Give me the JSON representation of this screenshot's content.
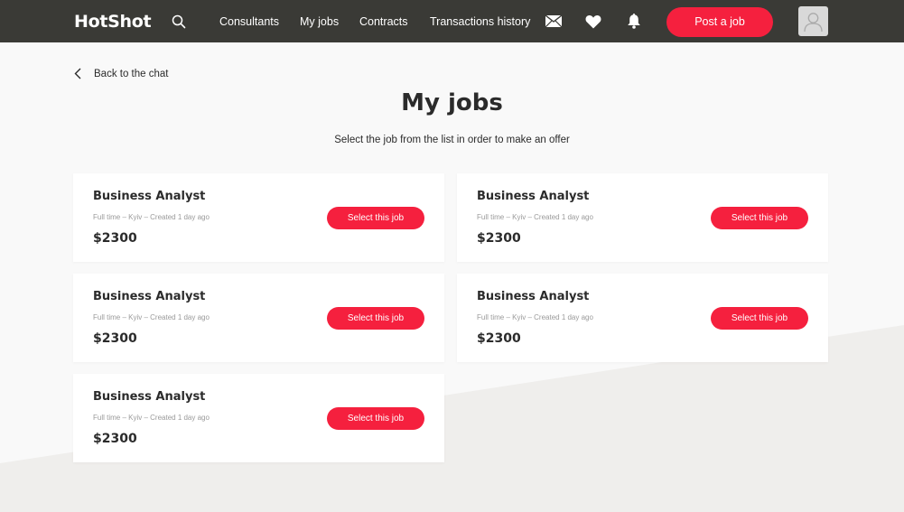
{
  "navbar": {
    "logo": "HotShot",
    "search_icon": "search-icon",
    "items": [
      {
        "id": "consultants",
        "label": "Consultants"
      },
      {
        "id": "my-jobs",
        "label": "My jobs"
      },
      {
        "id": "contracts",
        "label": "Contracts"
      },
      {
        "id": "transactions-history",
        "label": "Transactions history"
      }
    ],
    "icons": [
      "mail-icon",
      "heart-icon",
      "bell-icon"
    ],
    "post_job_label": "Post a job",
    "accent_color": "#f5203e",
    "bar_color": "#3a3a36"
  },
  "main": {
    "back_label": "Back to the chat",
    "title": "My jobs",
    "subtitle": "Select the job from the list in order to make an offer",
    "select_label": "Select this job",
    "jobs": [
      {
        "title": "Business Analyst",
        "meta": "Full time – Kyiv – Created 1 day ago",
        "price": "$2300"
      },
      {
        "title": "Business Analyst",
        "meta": "Full time – Kyiv – Created 1 day ago",
        "price": "$2300"
      },
      {
        "title": "Business Analyst",
        "meta": "Full time – Kyiv – Created 1 day ago",
        "price": "$2300"
      },
      {
        "title": "Business Analyst",
        "meta": "Full time – Kyiv – Created 1 day ago",
        "price": "$2300"
      },
      {
        "title": "Business Analyst",
        "meta": "Full time – Kyiv – Created 1 day ago",
        "price": "$2300"
      }
    ]
  }
}
